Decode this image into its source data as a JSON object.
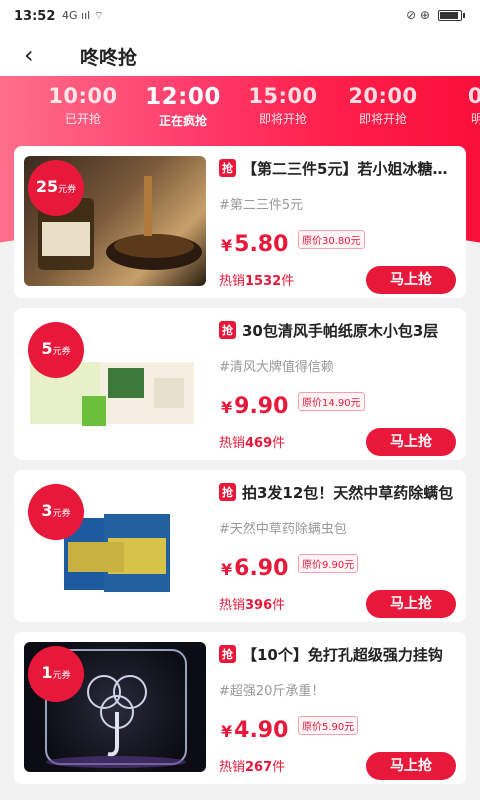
{
  "status": {
    "time": "13:52",
    "signal": "4G ııl ⌔",
    "right": "⊘ ⊕"
  },
  "nav": {
    "back_icon": "‹",
    "title": "咚咚抢"
  },
  "time_slots": [
    {
      "time": "0",
      "label": "抢"
    },
    {
      "time": "10:00",
      "label": "已开抢"
    },
    {
      "time": "12:00",
      "label": "正在疯抢"
    },
    {
      "time": "15:00",
      "label": "即将开抢"
    },
    {
      "time": "20:00",
      "label": "即将开抢"
    },
    {
      "time": "00",
      "label": "明日"
    }
  ],
  "battery_level": 0.8,
  "qiang_label": "抢",
  "buy_label": "马上抢",
  "coupon_unit": "元券",
  "yen": "¥",
  "products": [
    {
      "coupon": "25",
      "title": "【第二三件5元】若小姐冰糖秋梨膏",
      "tag": "#第二三件5元",
      "price": "5.80",
      "orig": "原价30.80元",
      "sold_prefix": "热销",
      "sold_num": "1532",
      "sold_suffix": "件"
    },
    {
      "coupon": "5",
      "title": "30包清风手帕纸原木小包3层",
      "tag": "#清风大牌值得信赖",
      "price": "9.90",
      "orig": "原价14.90元",
      "sold_prefix": "热销",
      "sold_num": "469",
      "sold_suffix": "件"
    },
    {
      "coupon": "3",
      "title": "拍3发12包！天然中草药除螨包",
      "tag": "#天然中草药除螨虫包",
      "price": "6.90",
      "orig": "原价9.90元",
      "sold_prefix": "热销",
      "sold_num": "396",
      "sold_suffix": "件"
    },
    {
      "coupon": "1",
      "title": "【10个】免打孔超级强力挂钩",
      "tag": "#超强20斤承重！",
      "price": "4.90",
      "orig": "原价5.90元",
      "sold_prefix": "热销",
      "sold_num": "267",
      "sold_suffix": "件"
    }
  ]
}
